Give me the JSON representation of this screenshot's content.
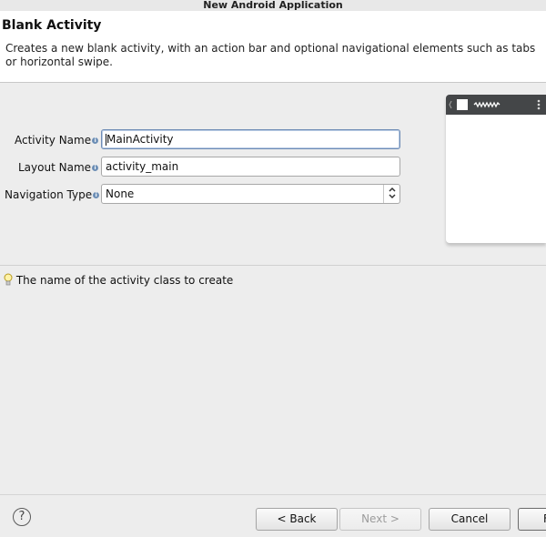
{
  "window": {
    "title": "New Android Application"
  },
  "header": {
    "title": "Blank Activity",
    "description": "Creates a new blank activity, with an action bar and optional navigational elements such as tabs or horizontal swipe."
  },
  "form": {
    "activity_name": {
      "label": "Activity Name",
      "value": "MainActivity"
    },
    "layout_name": {
      "label": "Layout Name",
      "value": "activity_main"
    },
    "navigation_type": {
      "label": "Navigation Type",
      "value": "None"
    }
  },
  "hint": {
    "text": "The name of the activity class to create",
    "icon": "lightbulb-icon"
  },
  "footer": {
    "help_icon": "?",
    "back_label": "< Back",
    "next_label": "Next >",
    "cancel_label": "Cancel",
    "finish_label": "F"
  },
  "colors": {
    "preview_bar": "#444648",
    "panel": "#ededed",
    "header": "#ffffff"
  }
}
